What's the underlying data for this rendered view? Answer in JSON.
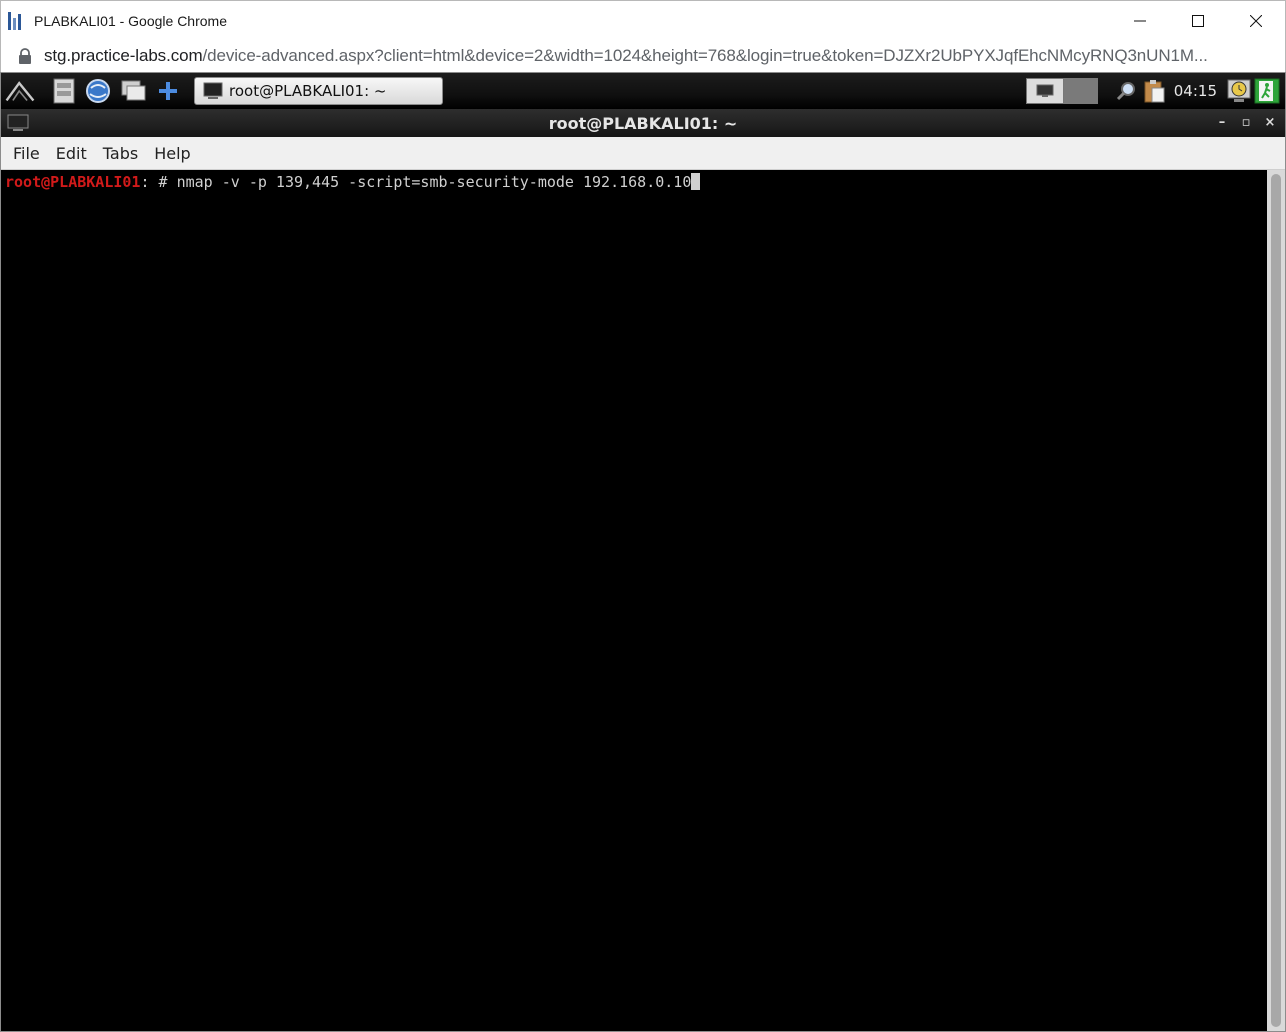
{
  "browser": {
    "window_title": "PLABKALI01 - Google Chrome",
    "url_domain": "stg.practice-labs.com",
    "url_path": "/device-advanced.aspx?client=html&device=2&width=1024&height=768&login=true&token=DJZXr2UbPYXJqfEhcNMcyRNQ3nUN1M..."
  },
  "panel": {
    "launchers": [
      "kali-menu-icon",
      "file-manager-icon",
      "web-browser-icon",
      "show-desktop-icon",
      "add-icon"
    ],
    "task_label": "root@PLABKALI01: ~",
    "clock": "04:15"
  },
  "terminal": {
    "title": "root@PLABKALI01: ~",
    "menu": [
      "File",
      "Edit",
      "Tabs",
      "Help"
    ],
    "prompt_user": "root@PLABKALI01",
    "prompt_suffix": ": # ",
    "command": "nmap -v -p 139,445 -script=smb-security-mode 192.168.0.10"
  },
  "colors": {
    "prompt_red": "#d11a1a",
    "terminal_bg": "#000000",
    "terminal_fg": "#d0d0d0"
  }
}
